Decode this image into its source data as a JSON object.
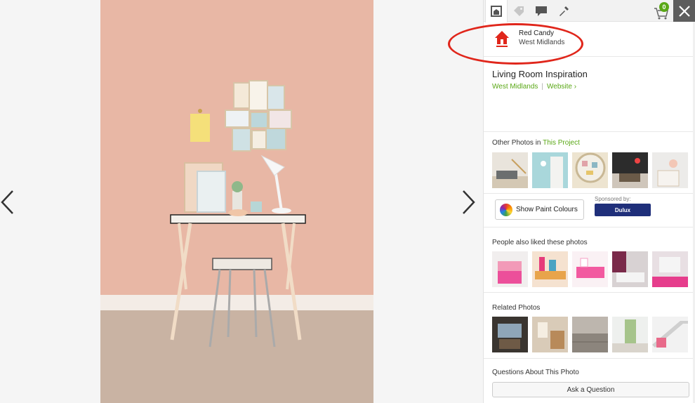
{
  "viewer": {
    "prev_label": "Previous photo",
    "next_label": "Next photo"
  },
  "tabs": [
    {
      "icon": "houzz-icon"
    },
    {
      "icon": "tag-icon"
    },
    {
      "icon": "comment-icon"
    },
    {
      "icon": "dropper-icon"
    }
  ],
  "cart": {
    "count": "0"
  },
  "pro": {
    "name": "Red Candy",
    "location": "West Midlands"
  },
  "project": {
    "title": "Living Room Inspiration",
    "location_link": "West Midlands",
    "separator": "|",
    "website_link": "Website ›"
  },
  "other_photos": {
    "label_prefix": "Other Photos in ",
    "label_link": "This Project"
  },
  "paint": {
    "button_label": "Show Paint Colours",
    "sponsored_label": "Sponsored by:",
    "sponsor_name": "Dulux"
  },
  "people_liked": {
    "label": "People also liked these photos"
  },
  "related": {
    "label": "Related Photos"
  },
  "questions": {
    "label": "Questions About This Photo",
    "ask_button": "Ask a Question"
  },
  "colors": {
    "accent_green": "#5aa816",
    "highlight_red": "#e0261b",
    "wall_pink": "#e8b8a6"
  }
}
